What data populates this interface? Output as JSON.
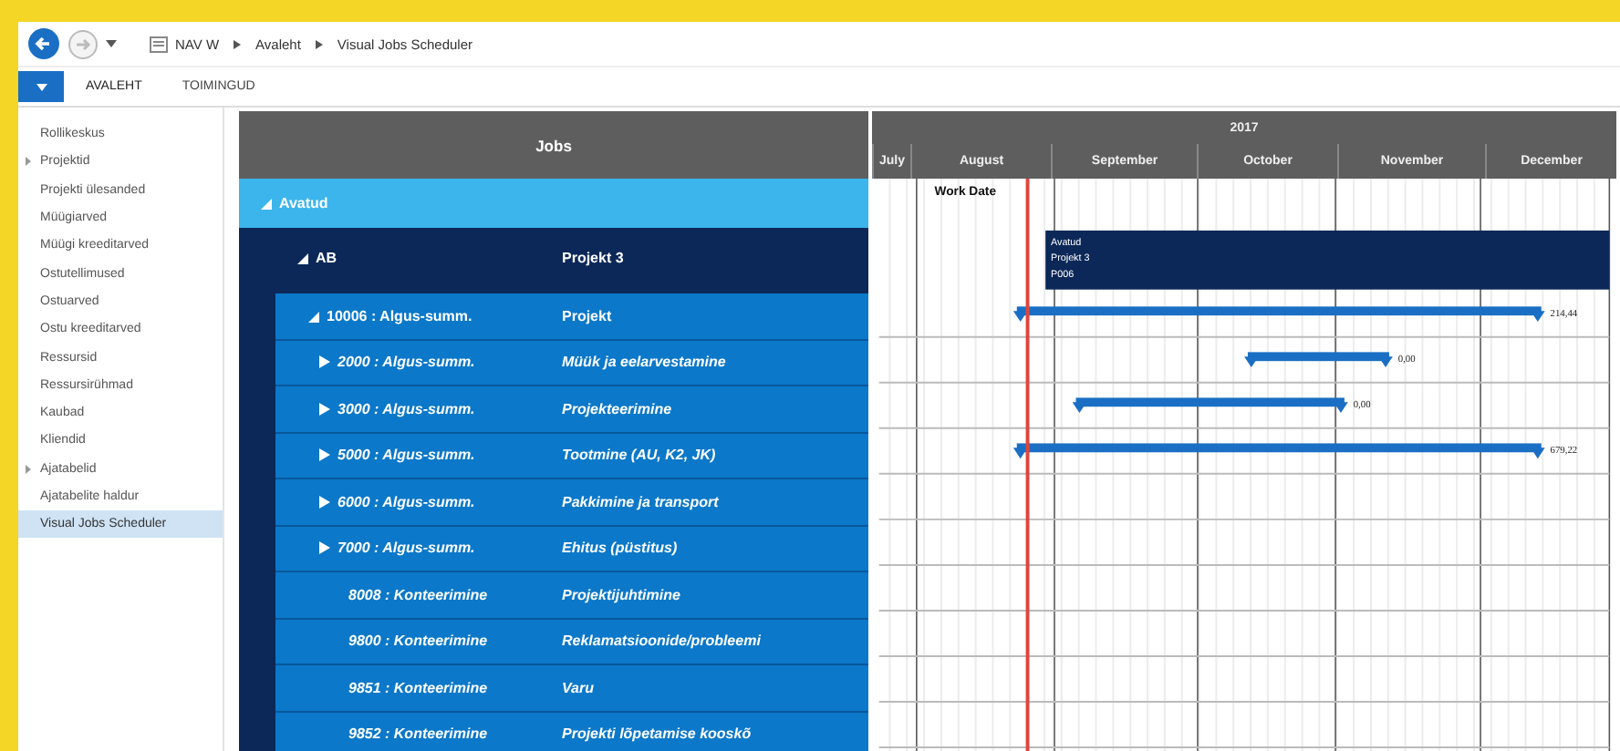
{
  "nav": {
    "breadcrumb": [
      "NAV W",
      "Avaleht",
      "Visual Jobs Scheduler"
    ]
  },
  "ribbon": {
    "tabs": [
      {
        "label": "AVALEHT",
        "selected": true
      },
      {
        "label": "TOIMINGUD",
        "selected": false
      }
    ]
  },
  "sidebar": {
    "items": [
      {
        "label": "Rollikeskus",
        "selected": false
      },
      {
        "label": "Projektid",
        "selected": false,
        "expanded": false
      },
      {
        "label": "Projekti ülesanded",
        "selected": false
      },
      {
        "label": "Müügiarved",
        "selected": false
      },
      {
        "label": "Müügi kreeditarved",
        "selected": false
      },
      {
        "label": "Ostutellimused",
        "selected": false
      },
      {
        "label": "Ostuarved",
        "selected": false
      },
      {
        "label": "Ostu kreeditarved",
        "selected": false
      },
      {
        "label": "Ressursid",
        "selected": false
      },
      {
        "label": "Ressursirühmad",
        "selected": false
      },
      {
        "label": "Kaubad",
        "selected": false
      },
      {
        "label": "Kliendid",
        "selected": false
      },
      {
        "label": "Ajatabelid",
        "selected": false,
        "expanded": false
      },
      {
        "label": "Ajatabelite haldur",
        "selected": false
      },
      {
        "label": "Visual Jobs Scheduler",
        "selected": true
      }
    ]
  },
  "jobs": {
    "title": "Jobs",
    "rows": [
      {
        "name": "Avatud",
        "expanded": true,
        "children": [
          {
            "name": "AB",
            "description": "Projekt 3",
            "expanded": true,
            "block_lines": [
              "Avatud",
              "Projekt 3",
              "P006"
            ],
            "children": [
              {
                "name": "10006 : Algus-summ.",
                "description": "Projekt",
                "expanded": true,
                "bar_label": "214,44",
                "children": [
                  {
                    "name": "2000 : Algus-summ.",
                    "description": "Müük ja eelarvestamine",
                    "expanded": false,
                    "bar_label": "0,00"
                  },
                  {
                    "name": "3000 : Algus-summ.",
                    "description": "Projekteerimine",
                    "expanded": false,
                    "bar_label": "0,00"
                  },
                  {
                    "name": "5000 : Algus-summ.",
                    "description": "Tootmine (AU, K2, JK)",
                    "expanded": false,
                    "bar_label": "679,22"
                  },
                  {
                    "name": "6000 : Algus-summ.",
                    "description": "Pakkimine ja transport",
                    "expanded": false
                  },
                  {
                    "name": "7000 : Algus-summ.",
                    "description": "Ehitus (püstitus)",
                    "expanded": false
                  },
                  {
                    "name": "8008 : Konteerimine",
                    "description": "Projektijuhtimine"
                  },
                  {
                    "name": "9800 : Konteerimine",
                    "description": "Reklamatsioonide/probleemi"
                  },
                  {
                    "name": "9851 : Konteerimine",
                    "description": "Varu"
                  },
                  {
                    "name": "9852 : Konteerimine",
                    "description": "Projekti lõpetamise kooskõ"
                  }
                ]
              }
            ]
          }
        ]
      }
    ]
  },
  "gantt": {
    "year": "2017",
    "months": [
      "July",
      "August",
      "September",
      "October",
      "November",
      "December"
    ],
    "today_label": "Work Date"
  }
}
